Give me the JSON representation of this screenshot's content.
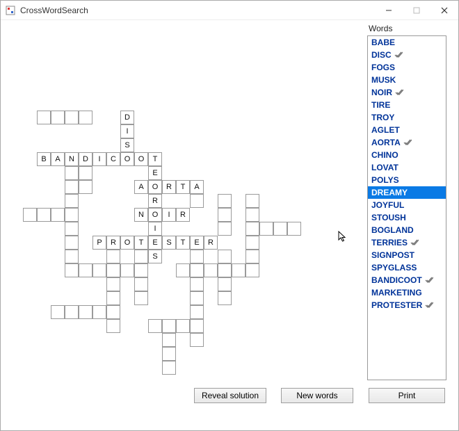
{
  "window": {
    "title": "CrossWordSearch"
  },
  "words_label": "Words",
  "words": [
    {
      "text": "BABE",
      "found": false,
      "selected": false
    },
    {
      "text": "DISC",
      "found": true,
      "selected": false
    },
    {
      "text": "FOGS",
      "found": false,
      "selected": false
    },
    {
      "text": "MUSK",
      "found": false,
      "selected": false
    },
    {
      "text": "NOIR",
      "found": true,
      "selected": false
    },
    {
      "text": "TIRE",
      "found": false,
      "selected": false
    },
    {
      "text": "TROY",
      "found": false,
      "selected": false
    },
    {
      "text": "AGLET",
      "found": false,
      "selected": false
    },
    {
      "text": "AORTA",
      "found": true,
      "selected": false
    },
    {
      "text": "CHINO",
      "found": false,
      "selected": false
    },
    {
      "text": "LOVAT",
      "found": false,
      "selected": false
    },
    {
      "text": "POLYS",
      "found": false,
      "selected": false
    },
    {
      "text": "DREAMY",
      "found": false,
      "selected": true
    },
    {
      "text": "JOYFUL",
      "found": false,
      "selected": false
    },
    {
      "text": "STOUSH",
      "found": false,
      "selected": false
    },
    {
      "text": "BOGLAND",
      "found": false,
      "selected": false
    },
    {
      "text": "TERRIES",
      "found": true,
      "selected": false
    },
    {
      "text": "SIGNPOST",
      "found": false,
      "selected": false
    },
    {
      "text": "SPYGLASS",
      "found": false,
      "selected": false
    },
    {
      "text": "BANDICOOT",
      "found": true,
      "selected": false
    },
    {
      "text": "MARKETING",
      "found": false,
      "selected": false
    },
    {
      "text": "PROTESTER",
      "found": true,
      "selected": false
    }
  ],
  "buttons": {
    "reveal": "Reveal solution",
    "new": "New words",
    "print": "Print"
  },
  "grid": {
    "cell_size": 20,
    "cells": [
      {
        "r": 0,
        "c": 0,
        "t": ""
      },
      {
        "r": 0,
        "c": 1,
        "t": ""
      },
      {
        "r": 0,
        "c": 2,
        "t": ""
      },
      {
        "r": 0,
        "c": 3,
        "t": ""
      },
      {
        "r": 0,
        "c": 6,
        "t": "D"
      },
      {
        "r": 1,
        "c": 6,
        "t": "I"
      },
      {
        "r": 2,
        "c": 6,
        "t": "S"
      },
      {
        "r": 3,
        "c": 0,
        "t": "B"
      },
      {
        "r": 3,
        "c": 1,
        "t": "A"
      },
      {
        "r": 3,
        "c": 2,
        "t": "N"
      },
      {
        "r": 3,
        "c": 3,
        "t": "D"
      },
      {
        "r": 3,
        "c": 4,
        "t": "I"
      },
      {
        "r": 3,
        "c": 5,
        "t": "C"
      },
      {
        "r": 3,
        "c": 6,
        "t": "O"
      },
      {
        "r": 3,
        "c": 7,
        "t": "O"
      },
      {
        "r": 3,
        "c": 8,
        "t": "T"
      },
      {
        "r": 4,
        "c": 2,
        "t": ""
      },
      {
        "r": 4,
        "c": 3,
        "t": ""
      },
      {
        "r": 4,
        "c": 8,
        "t": "E"
      },
      {
        "r": 5,
        "c": 2,
        "t": ""
      },
      {
        "r": 5,
        "c": 3,
        "t": ""
      },
      {
        "r": 5,
        "c": 7,
        "t": "A"
      },
      {
        "r": 5,
        "c": 8,
        "t": "O"
      },
      {
        "r": 5,
        "c": 9,
        "t": "R"
      },
      {
        "r": 5,
        "c": 10,
        "t": "T"
      },
      {
        "r": 5,
        "c": 11,
        "t": "A"
      },
      {
        "r": 6,
        "c": 2,
        "t": ""
      },
      {
        "r": 6,
        "c": 8,
        "t": "R"
      },
      {
        "r": 6,
        "c": 11,
        "t": ""
      },
      {
        "r": 6,
        "c": 13,
        "t": ""
      },
      {
        "r": 6,
        "c": 15,
        "t": ""
      },
      {
        "r": 7,
        "c": -1,
        "t": ""
      },
      {
        "r": 7,
        "c": 0,
        "t": ""
      },
      {
        "r": 7,
        "c": 1,
        "t": ""
      },
      {
        "r": 7,
        "c": 2,
        "t": ""
      },
      {
        "r": 7,
        "c": 7,
        "t": "N"
      },
      {
        "r": 7,
        "c": 8,
        "t": "O"
      },
      {
        "r": 7,
        "c": 9,
        "t": "I"
      },
      {
        "r": 7,
        "c": 10,
        "t": "R"
      },
      {
        "r": 7,
        "c": 13,
        "t": ""
      },
      {
        "r": 7,
        "c": 15,
        "t": ""
      },
      {
        "r": 8,
        "c": 2,
        "t": ""
      },
      {
        "r": 8,
        "c": 8,
        "t": "I"
      },
      {
        "r": 8,
        "c": 13,
        "t": ""
      },
      {
        "r": 8,
        "c": 15,
        "t": ""
      },
      {
        "r": 8,
        "c": 16,
        "t": ""
      },
      {
        "r": 8,
        "c": 17,
        "t": ""
      },
      {
        "r": 8,
        "c": 18,
        "t": ""
      },
      {
        "r": 9,
        "c": 2,
        "t": ""
      },
      {
        "r": 9,
        "c": 4,
        "t": "P"
      },
      {
        "r": 9,
        "c": 5,
        "t": "R"
      },
      {
        "r": 9,
        "c": 6,
        "t": "O"
      },
      {
        "r": 9,
        "c": 7,
        "t": "T"
      },
      {
        "r": 9,
        "c": 8,
        "t": "E"
      },
      {
        "r": 9,
        "c": 9,
        "t": "S"
      },
      {
        "r": 9,
        "c": 10,
        "t": "T"
      },
      {
        "r": 9,
        "c": 11,
        "t": "E"
      },
      {
        "r": 9,
        "c": 12,
        "t": "R"
      },
      {
        "r": 9,
        "c": 15,
        "t": ""
      },
      {
        "r": 10,
        "c": 2,
        "t": ""
      },
      {
        "r": 10,
        "c": 5,
        "t": ""
      },
      {
        "r": 10,
        "c": 7,
        "t": ""
      },
      {
        "r": 10,
        "c": 8,
        "t": "S"
      },
      {
        "r": 10,
        "c": 11,
        "t": ""
      },
      {
        "r": 10,
        "c": 13,
        "t": ""
      },
      {
        "r": 10,
        "c": 15,
        "t": ""
      },
      {
        "r": 11,
        "c": 2,
        "t": ""
      },
      {
        "r": 11,
        "c": 3,
        "t": ""
      },
      {
        "r": 11,
        "c": 4,
        "t": ""
      },
      {
        "r": 11,
        "c": 5,
        "t": ""
      },
      {
        "r": 11,
        "c": 6,
        "t": ""
      },
      {
        "r": 11,
        "c": 7,
        "t": ""
      },
      {
        "r": 11,
        "c": 10,
        "t": ""
      },
      {
        "r": 11,
        "c": 11,
        "t": ""
      },
      {
        "r": 11,
        "c": 12,
        "t": ""
      },
      {
        "r": 11,
        "c": 13,
        "t": ""
      },
      {
        "r": 11,
        "c": 14,
        "t": ""
      },
      {
        "r": 11,
        "c": 15,
        "t": ""
      },
      {
        "r": 12,
        "c": 5,
        "t": ""
      },
      {
        "r": 12,
        "c": 7,
        "t": ""
      },
      {
        "r": 12,
        "c": 11,
        "t": ""
      },
      {
        "r": 12,
        "c": 13,
        "t": ""
      },
      {
        "r": 13,
        "c": 5,
        "t": ""
      },
      {
        "r": 13,
        "c": 7,
        "t": ""
      },
      {
        "r": 13,
        "c": 11,
        "t": ""
      },
      {
        "r": 13,
        "c": 13,
        "t": ""
      },
      {
        "r": 14,
        "c": 1,
        "t": ""
      },
      {
        "r": 14,
        "c": 2,
        "t": ""
      },
      {
        "r": 14,
        "c": 3,
        "t": ""
      },
      {
        "r": 14,
        "c": 4,
        "t": ""
      },
      {
        "r": 14,
        "c": 5,
        "t": ""
      },
      {
        "r": 14,
        "c": 11,
        "t": ""
      },
      {
        "r": 15,
        "c": 5,
        "t": ""
      },
      {
        "r": 15,
        "c": 8,
        "t": ""
      },
      {
        "r": 15,
        "c": 9,
        "t": ""
      },
      {
        "r": 15,
        "c": 10,
        "t": ""
      },
      {
        "r": 15,
        "c": 11,
        "t": ""
      },
      {
        "r": 16,
        "c": 9,
        "t": ""
      },
      {
        "r": 16,
        "c": 11,
        "t": ""
      },
      {
        "r": 17,
        "c": 9,
        "t": ""
      },
      {
        "r": 18,
        "c": 9,
        "t": ""
      }
    ]
  }
}
